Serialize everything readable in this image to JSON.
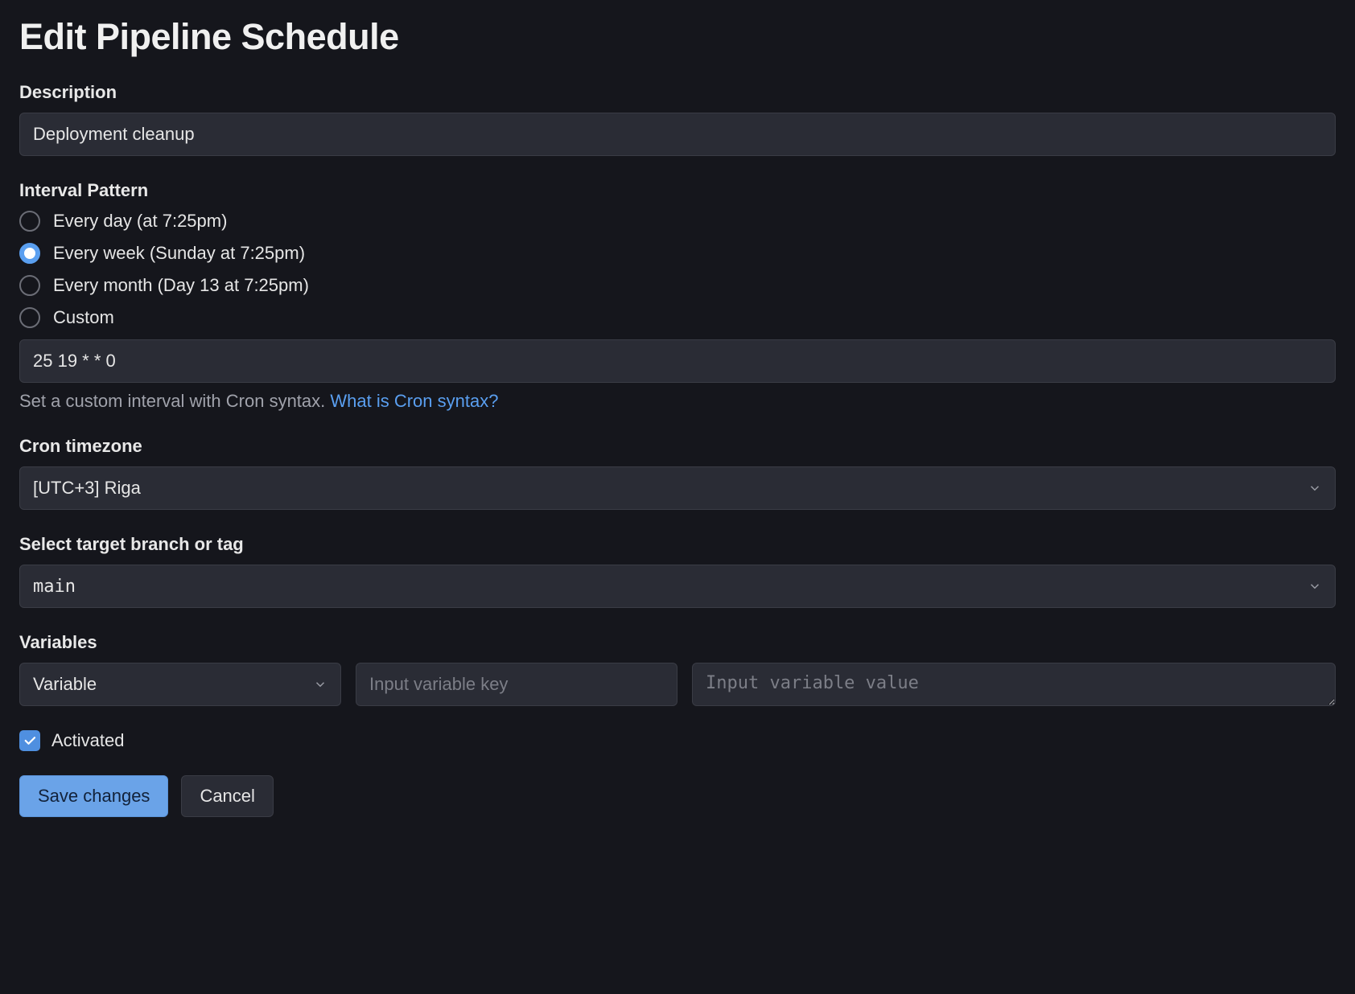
{
  "page_title": "Edit Pipeline Schedule",
  "description": {
    "label": "Description",
    "value": "Deployment cleanup"
  },
  "interval": {
    "label": "Interval Pattern",
    "options": [
      {
        "label": "Every day (at 7:25pm)",
        "selected": false
      },
      {
        "label": "Every week (Sunday at 7:25pm)",
        "selected": true
      },
      {
        "label": "Every month (Day 13 at 7:25pm)",
        "selected": false
      },
      {
        "label": "Custom",
        "selected": false
      }
    ],
    "cron_value": "25 19 * * 0",
    "helper_prefix": "Set a custom interval with Cron syntax. ",
    "helper_link": "What is Cron syntax?"
  },
  "timezone": {
    "label": "Cron timezone",
    "value": "[UTC+3] Riga"
  },
  "target": {
    "label": "Select target branch or tag",
    "value": "main"
  },
  "variables": {
    "label": "Variables",
    "type_value": "Variable",
    "key_placeholder": "Input variable key",
    "value_placeholder": "Input variable value"
  },
  "activated": {
    "label": "Activated",
    "checked": true
  },
  "buttons": {
    "save": "Save changes",
    "cancel": "Cancel"
  }
}
